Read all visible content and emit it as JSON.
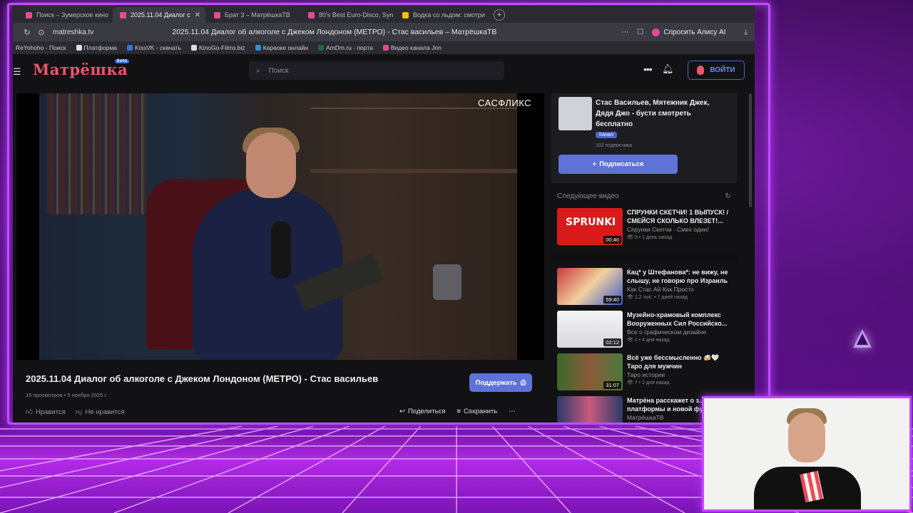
{
  "browser": {
    "tabs": [
      {
        "title": "Поиск – Зумерское кино",
        "color": "#e6489a",
        "active": false
      },
      {
        "title": "2025.11.04 Диалог с",
        "color": "#e6489a",
        "active": true
      },
      {
        "title": "Брат 3 – МатрёшкаТВ",
        "color": "#e6489a",
        "active": false
      },
      {
        "title": "80's Best Euro-Disco, Syn",
        "color": "#e6489a",
        "active": false
      },
      {
        "title": "Водка со льдом: смотри",
        "color": "#f2c200",
        "active": false
      }
    ],
    "url": "matreshka.tv",
    "page_title": "2025.11.04 Диалог об алкоголе с Джеком Лондоном (МЕТРО) - Стас васильев – МатрёшкаТВ",
    "alice_label": "Спросить Алису AI",
    "bookmarks": [
      {
        "label": "ReYohoho - Поиск",
        "color": "#2aa0d8"
      },
      {
        "label": "Платформа",
        "color": "#111111"
      },
      {
        "label": "KissVK - скачать",
        "color": "#2a78d8"
      },
      {
        "label": "KinoGo-Films.biz",
        "color": "#dddddd"
      },
      {
        "label": "Караоке онлайн",
        "color": "#2a90d8"
      },
      {
        "label": "AmDm.ru - порта",
        "color": "#1a6a3a"
      },
      {
        "label": "Видео канала Jon",
        "color": "#e6489a"
      }
    ]
  },
  "site": {
    "logo": "Матрёшка",
    "logo_badge": "beta",
    "search_placeholder": "Поиск",
    "login_label": "ВОЙТИ"
  },
  "video": {
    "watermark": "САСФЛИКС",
    "title": "2025.11.04 Диалог об алкоголе с Джеком Лондоном (МЕТРО) - Стас васильев",
    "views": "15 просмотров",
    "date": "5 ноября 2025 г.",
    "support_label": "Поддержать",
    "like_label": "Нравится",
    "dislike_label": "Не нравится",
    "share_label": "Поделиться",
    "save_label": "Сохранить"
  },
  "channel": {
    "name": "Стас Васильев, Мятежник Джек, Дядя Джо - бусти смотреть бесплатно",
    "badge": "Канал",
    "subscribers": "102 подписчика",
    "subscribe_label": "Подписаться"
  },
  "next_header": "Следующее видео",
  "next_video": {
    "title": "СПРУНКИ СКЕТЧИ! 1 ВЫПУСК! / СМЕЙСЯ СКОЛЬКО ВЛЕЗЕТ!...",
    "channel": "Спрунки Скетчи - Смех один!",
    "stats": "5 • 1 день назад",
    "duration": "00:40",
    "thumb_text": "SPRUNKI",
    "thumb_color": "#d81a1a"
  },
  "recommendations": [
    {
      "title": "Кац* у Штефанова*: не вижу, не слышу, не говорю про Израиль",
      "channel": "Как Стас Ай Как Просто",
      "stats": "1,2 тыс. • 7 дней назад",
      "duration": "59:40",
      "thumb_color": "#c83a3a"
    },
    {
      "title": "Музейно-храмовый комплекс Вооруженных Сил Российско...",
      "channel": "Все о графическом дизайне",
      "stats": "1 • 4 дня назад",
      "duration": "02:12",
      "thumb_color": "#e8e8ea"
    },
    {
      "title": "Всё уже бессмысленно 🍻🤍 Таро для мужчин",
      "channel": "Таро истории",
      "stats": "7 • 2 дня назад",
      "duration": "31:07",
      "thumb_color": "#4a7a3a"
    },
    {
      "title": "Матрёна расскажет о з... платформы и новой фу...",
      "channel": "МатрёшкаТВ",
      "stats": "",
      "duration": "",
      "thumb_color": "#2a3a6a"
    }
  ]
}
